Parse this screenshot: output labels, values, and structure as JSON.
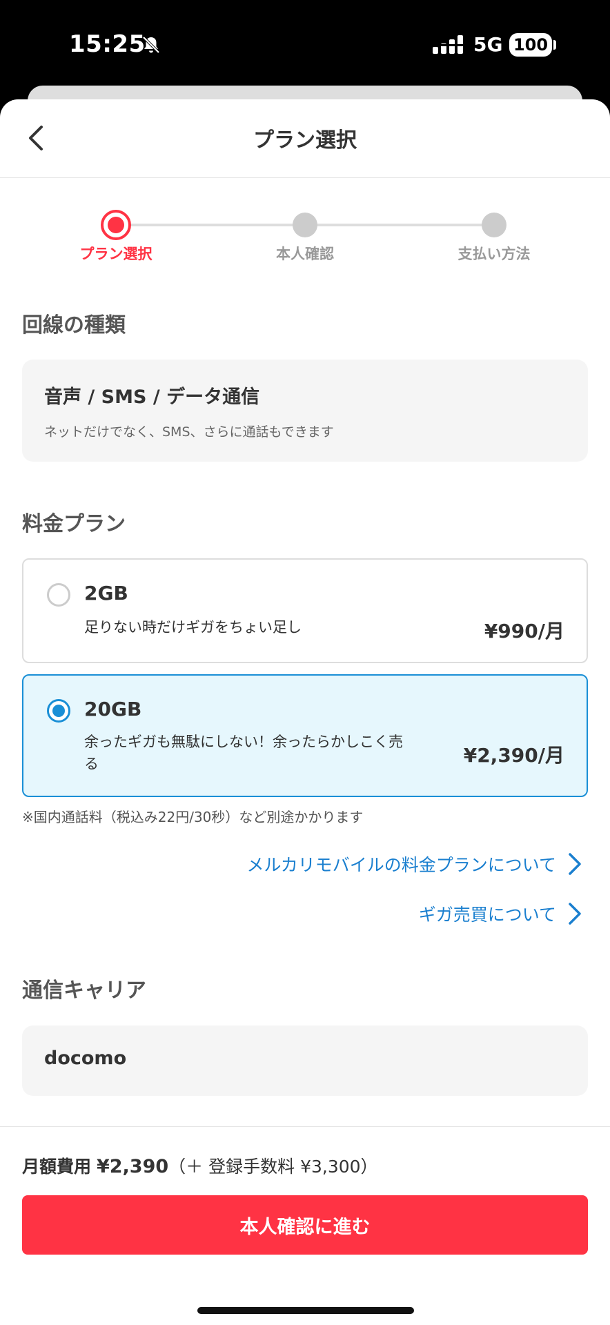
{
  "status_bar": {
    "time": "15:25",
    "network": "5G",
    "battery": "100"
  },
  "header": {
    "title": "プラン選択",
    "back_icon": "chevron-left-icon"
  },
  "stepper": {
    "steps": [
      {
        "label": "プラン選択",
        "state": "active"
      },
      {
        "label": "本人確認",
        "state": "inactive"
      },
      {
        "label": "支払い方法",
        "state": "inactive"
      }
    ],
    "active_color": "#ff3344"
  },
  "line_type": {
    "section_title": "回線の種類",
    "name": "音声 / SMS / データ通信",
    "description": "ネットだけでなく、SMS、さらに通話もできます"
  },
  "plans": {
    "section_title": "料金プラン",
    "options": [
      {
        "name": "2GB",
        "description": "足りない時だけギガをちょい足し",
        "price": "¥990/月",
        "selected": false
      },
      {
        "name": "20GB",
        "description": "余ったギガも無駄にしない！余ったらかしこく売る",
        "price": "¥2,390/月",
        "selected": true
      }
    ],
    "note": "※国内通話料（税込み22円/30秒）など別途かかります",
    "selected_color": "#1a8fd6"
  },
  "links": [
    {
      "label": "メルカリモバイルの料金プランについて",
      "icon": "chevron-right-icon"
    },
    {
      "label": "ギガ売買について",
      "icon": "chevron-right-icon"
    }
  ],
  "carrier": {
    "section_title": "通信キャリア",
    "name": "docomo"
  },
  "footer": {
    "fee_label": "月額費用",
    "fee_amount": "¥2,390",
    "fee_extra": "（＋ 登録手数料 ¥3,300）",
    "cta_label": "本人確認に進む",
    "cta_color": "#ff3344"
  }
}
